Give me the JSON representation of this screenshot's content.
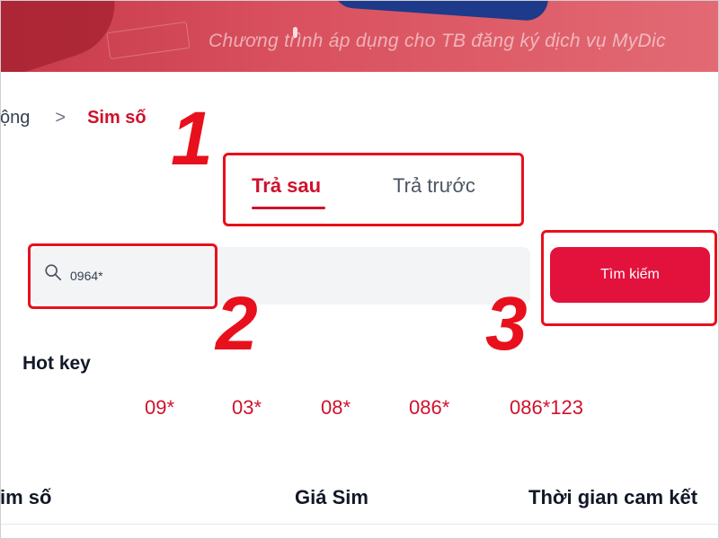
{
  "banner": {
    "text": "Chương trình áp dụng cho TB đăng ký dịch vụ MyDic"
  },
  "breadcrumb": {
    "previous": "ộng",
    "separator": ">",
    "current": "Sim số"
  },
  "tabs": [
    {
      "label": "Trả sau",
      "active": true
    },
    {
      "label": "Trả trước",
      "active": false
    }
  ],
  "search": {
    "value": "0964*",
    "placeholder": "",
    "button_label": "Tìm kiếm"
  },
  "hotkeys": {
    "title": "Hot key",
    "items": [
      "09*",
      "03*",
      "08*",
      "086*",
      "086*123"
    ]
  },
  "table": {
    "headers": [
      "im số",
      "Giá Sim",
      "Thời gian cam kết"
    ]
  },
  "annotations": {
    "step1": "1",
    "step2": "2",
    "step3": "3"
  },
  "colors": {
    "accent": "#d0112b",
    "button": "#e3123c",
    "annotation": "#e8101c"
  },
  "icons": {
    "search": "search-icon",
    "breadcrumb_separator": "chevron-right-icon"
  }
}
